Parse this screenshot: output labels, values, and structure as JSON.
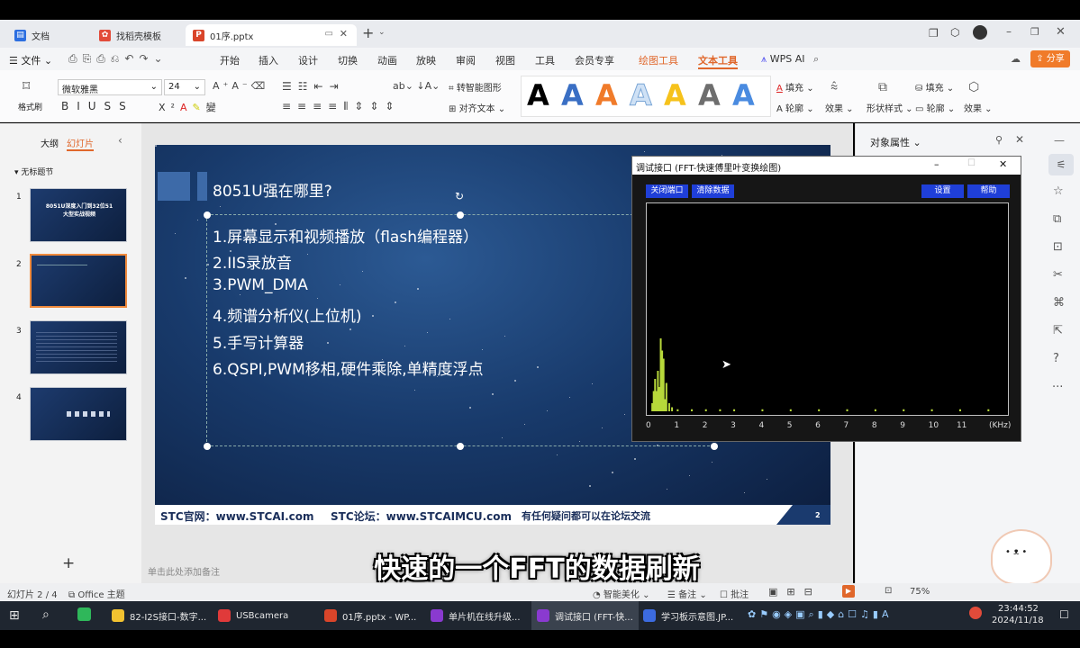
{
  "tabs": [
    {
      "label": "文档"
    },
    {
      "label": "找稻壳模板"
    },
    {
      "label": "01序.pptx"
    }
  ],
  "menu": {
    "file": "文件",
    "items": [
      "开始",
      "插入",
      "设计",
      "切换",
      "动画",
      "放映",
      "审阅",
      "视图",
      "工具",
      "会员专享",
      "绘图工具",
      "文本工具"
    ],
    "wps_ai": "WPS AI",
    "share": "分享"
  },
  "ribbon": {
    "format_painter": "格式刷",
    "font": "微软雅黑",
    "size": "24",
    "smart_shape": "转智能图形",
    "align_text": "对齐文本",
    "fill": "填充",
    "outline": "轮廓",
    "effect": "效果",
    "shape_style": "形状样式",
    "fill2": "填充",
    "outline2": "轮廓",
    "effect2": "效果",
    "wordart_colors": [
      "#000000",
      "#3a6fc4",
      "#f07b2a",
      "#9fc6ee",
      "#f6c21b",
      "#6e6e6e",
      "#4a8be0"
    ]
  },
  "left_pane": {
    "outline_tab": "大纲",
    "slides_tab": "幻灯片",
    "section": "无标题节",
    "slide_numbers": [
      "1",
      "2",
      "3",
      "4"
    ],
    "thumb1_title": "8051U深度入门到32位51大型实战视频",
    "add": "+"
  },
  "slide": {
    "title": "8051U强在哪里?",
    "bullets": [
      "1.屏幕显示和视频播放（flash编程器）",
      "2.IIS录放音",
      "3.PWM_DMA",
      "4.频谱分析仪(上位机)",
      "5.手写计算器",
      "6.QSPI,PWM移相,硬件乘除,单精度浮点"
    ],
    "footer_site": "STC官网：www.STCAI.com",
    "footer_forum": "STC论坛：www.STCAIMCU.com",
    "footer_note": "有任何疑问都可以在论坛交流",
    "page": "2",
    "notes_placeholder": "单击此处添加备注"
  },
  "dialog": {
    "title": "调试接口 (FFT-快速傅里叶变换绘图)",
    "btn_close_port": "关闭端口",
    "btn_clear": "清除数据",
    "btn_settings": "设置",
    "btn_help": "帮助",
    "unit": "(KHz)"
  },
  "chart_data": {
    "type": "bar",
    "title": "",
    "xlabel": "(KHz)",
    "ylabel": "",
    "xlim": [
      0,
      12.5
    ],
    "ylim": [
      0,
      1
    ],
    "xticks": [
      "0",
      "1",
      "2",
      "3",
      "4",
      "5",
      "6",
      "7",
      "8",
      "9",
      "10",
      "11"
    ],
    "series": [
      {
        "values": [
          [
            0.1,
            0.04
          ],
          [
            0.15,
            0.1
          ],
          [
            0.2,
            0.16
          ],
          [
            0.25,
            0.1
          ],
          [
            0.3,
            0.2
          ],
          [
            0.35,
            0.12
          ],
          [
            0.4,
            0.36
          ],
          [
            0.45,
            0.3
          ],
          [
            0.5,
            0.26
          ],
          [
            0.55,
            0.06
          ],
          [
            0.6,
            0.14
          ],
          [
            0.7,
            0.04
          ],
          [
            0.8,
            0.02
          ],
          [
            1.0,
            0.01
          ],
          [
            1.5,
            0.01
          ],
          [
            2.0,
            0.01
          ],
          [
            2.5,
            0.01
          ],
          [
            3.0,
            0.01
          ],
          [
            4.0,
            0.01
          ],
          [
            5.0,
            0.01
          ],
          [
            6.0,
            0.01
          ],
          [
            7.0,
            0.01
          ],
          [
            8.0,
            0.01
          ],
          [
            9.0,
            0.01
          ],
          [
            10.0,
            0.01
          ],
          [
            11.0,
            0.01
          ],
          [
            12.0,
            0.01
          ]
        ]
      }
    ],
    "color": "#b7d83a"
  },
  "right_pane": {
    "title": "对象属性"
  },
  "status": {
    "slide": "幻灯片 2 / 4",
    "theme": "Office 主题",
    "beautify": "智能美化",
    "notes": "备注",
    "comments": "批注",
    "zoom": "75%"
  },
  "subtitle": "快速的一个FFT的数据刷新",
  "taskbar": {
    "items": [
      "82-I2S接口-数字...",
      "USBcamera",
      "01序.pptx - WP...",
      "单片机在线升级...",
      "调试接口 (FFT-快...",
      "学习板示意图.JP..."
    ],
    "time": "23:44:52",
    "date": "2024/11/18"
  }
}
